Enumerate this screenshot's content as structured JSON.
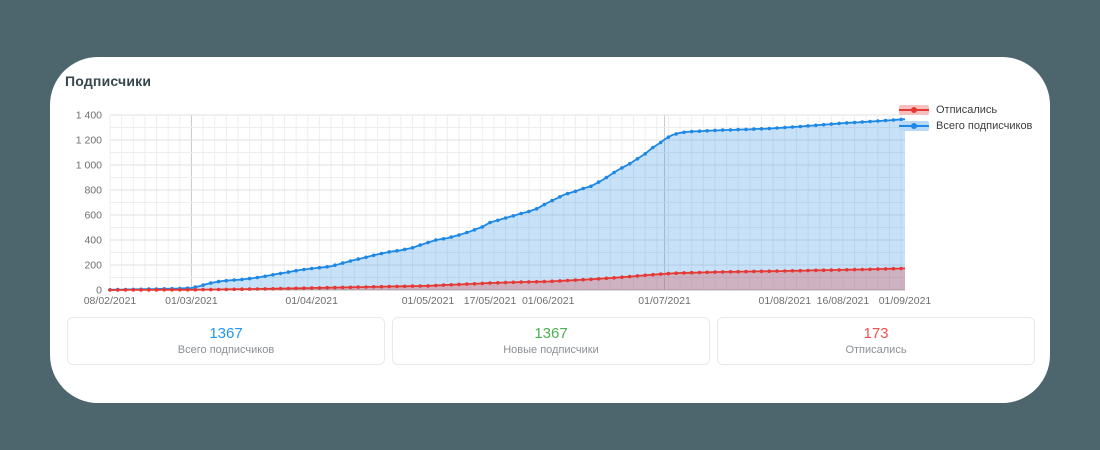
{
  "page": {
    "title": "Подписчики"
  },
  "chart_data": {
    "type": "area",
    "title": "Подписчики",
    "grid_on": true,
    "legend_position": "top-right",
    "x_axis": {
      "start_label": "08/02/2021",
      "end_label": "01/09/2021",
      "total_days": 205,
      "ticks": [
        {
          "label": "08/02/2021",
          "day": 0
        },
        {
          "label": "01/03/2021",
          "day": 21
        },
        {
          "label": "01/04/2021",
          "day": 52
        },
        {
          "label": "01/05/2021",
          "day": 82
        },
        {
          "label": "17/05/2021",
          "day": 98
        },
        {
          "label": "01/06/2021",
          "day": 113
        },
        {
          "label": "01/07/2021",
          "day": 143
        },
        {
          "label": "01/08/2021",
          "day": 174
        },
        {
          "label": "16/08/2021",
          "day": 189
        },
        {
          "label": "01/09/2021",
          "day": 205
        }
      ],
      "minor_grid_interval_days": 3,
      "emphasized_grid_days": [
        21,
        143
      ]
    },
    "y_axis": {
      "min": 0,
      "max": 1400,
      "major_step": 200,
      "minor_step": 100,
      "tick_labels": [
        "0",
        "200",
        "400",
        "600",
        "800",
        "1 000",
        "1 200",
        "1 400"
      ]
    },
    "series": [
      {
        "name": "Отписались",
        "color": "#e53935",
        "fill": "rgba(229,57,53,0.28)",
        "legend_band": "#f6c0be",
        "final_value": 173,
        "anchors": [
          [
            0,
            0
          ],
          [
            10,
            1
          ],
          [
            21,
            2
          ],
          [
            28,
            4
          ],
          [
            35,
            7
          ],
          [
            42,
            10
          ],
          [
            49,
            14
          ],
          [
            52,
            16
          ],
          [
            59,
            20
          ],
          [
            66,
            24
          ],
          [
            72,
            28
          ],
          [
            82,
            33
          ],
          [
            88,
            42
          ],
          [
            94,
            50
          ],
          [
            98,
            56
          ],
          [
            104,
            62
          ],
          [
            110,
            66
          ],
          [
            113,
            68
          ],
          [
            118,
            76
          ],
          [
            123,
            84
          ],
          [
            127,
            92
          ],
          [
            131,
            100
          ],
          [
            135,
            110
          ],
          [
            139,
            120
          ],
          [
            143,
            130
          ],
          [
            147,
            136
          ],
          [
            152,
            140
          ],
          [
            157,
            144
          ],
          [
            163,
            147
          ],
          [
            169,
            150
          ],
          [
            174,
            152
          ],
          [
            180,
            156
          ],
          [
            185,
            159
          ],
          [
            189,
            161
          ],
          [
            195,
            165
          ],
          [
            200,
            169
          ],
          [
            205,
            173
          ]
        ]
      },
      {
        "name": "Всего подписчиков",
        "color": "#1e88e5",
        "fill": "rgba(30,136,229,0.25)",
        "legend_band": "#b9d9f6",
        "final_value": 1367,
        "anchors": [
          [
            0,
            2
          ],
          [
            6,
            5
          ],
          [
            12,
            8
          ],
          [
            18,
            12
          ],
          [
            21,
            16
          ],
          [
            23,
            30
          ],
          [
            25,
            48
          ],
          [
            27,
            62
          ],
          [
            29,
            72
          ],
          [
            32,
            80
          ],
          [
            34,
            84
          ],
          [
            37,
            95
          ],
          [
            40,
            110
          ],
          [
            43,
            128
          ],
          [
            46,
            143
          ],
          [
            49,
            160
          ],
          [
            52,
            172
          ],
          [
            55,
            182
          ],
          [
            57,
            190
          ],
          [
            60,
            215
          ],
          [
            63,
            240
          ],
          [
            66,
            262
          ],
          [
            69,
            285
          ],
          [
            72,
            305
          ],
          [
            75,
            318
          ],
          [
            78,
            338
          ],
          [
            82,
            380
          ],
          [
            84,
            400
          ],
          [
            87,
            415
          ],
          [
            90,
            440
          ],
          [
            93,
            470
          ],
          [
            96,
            505
          ],
          [
            98,
            540
          ],
          [
            100,
            558
          ],
          [
            103,
            585
          ],
          [
            106,
            612
          ],
          [
            108,
            628
          ],
          [
            110,
            650
          ],
          [
            113,
            700
          ],
          [
            115,
            730
          ],
          [
            117,
            762
          ],
          [
            120,
            790
          ],
          [
            122,
            812
          ],
          [
            124,
            830
          ],
          [
            127,
            880
          ],
          [
            129,
            920
          ],
          [
            131,
            960
          ],
          [
            134,
            1010
          ],
          [
            136,
            1050
          ],
          [
            138,
            1090
          ],
          [
            140,
            1140
          ],
          [
            142,
            1180
          ],
          [
            143,
            1205
          ],
          [
            145,
            1240
          ],
          [
            147,
            1258
          ],
          [
            150,
            1268
          ],
          [
            153,
            1272
          ],
          [
            157,
            1278
          ],
          [
            161,
            1282
          ],
          [
            165,
            1286
          ],
          [
            170,
            1292
          ],
          [
            174,
            1300
          ],
          [
            178,
            1308
          ],
          [
            181,
            1315
          ],
          [
            185,
            1325
          ],
          [
            189,
            1335
          ],
          [
            193,
            1342
          ],
          [
            197,
            1350
          ],
          [
            201,
            1358
          ],
          [
            205,
            1367
          ]
        ]
      }
    ]
  },
  "summary_cards": [
    {
      "value": "1367",
      "label": "Всего подписчиков",
      "color": "#2196f3"
    },
    {
      "value": "1367",
      "label": "Новые подписчики",
      "color": "#4caf50"
    },
    {
      "value": "173",
      "label": "Отписались",
      "color": "#ef5350"
    }
  ],
  "colors": {
    "page_background": "#4d666e",
    "panel_background": "#ffffff",
    "grid_minor": "#eeeeee",
    "grid_major": "#e2e2e2",
    "grid_emphasized": "#c8cacc",
    "axis_line": "#b7babc",
    "axis_text": "#6e6e6e",
    "title_text": "#37474f"
  }
}
